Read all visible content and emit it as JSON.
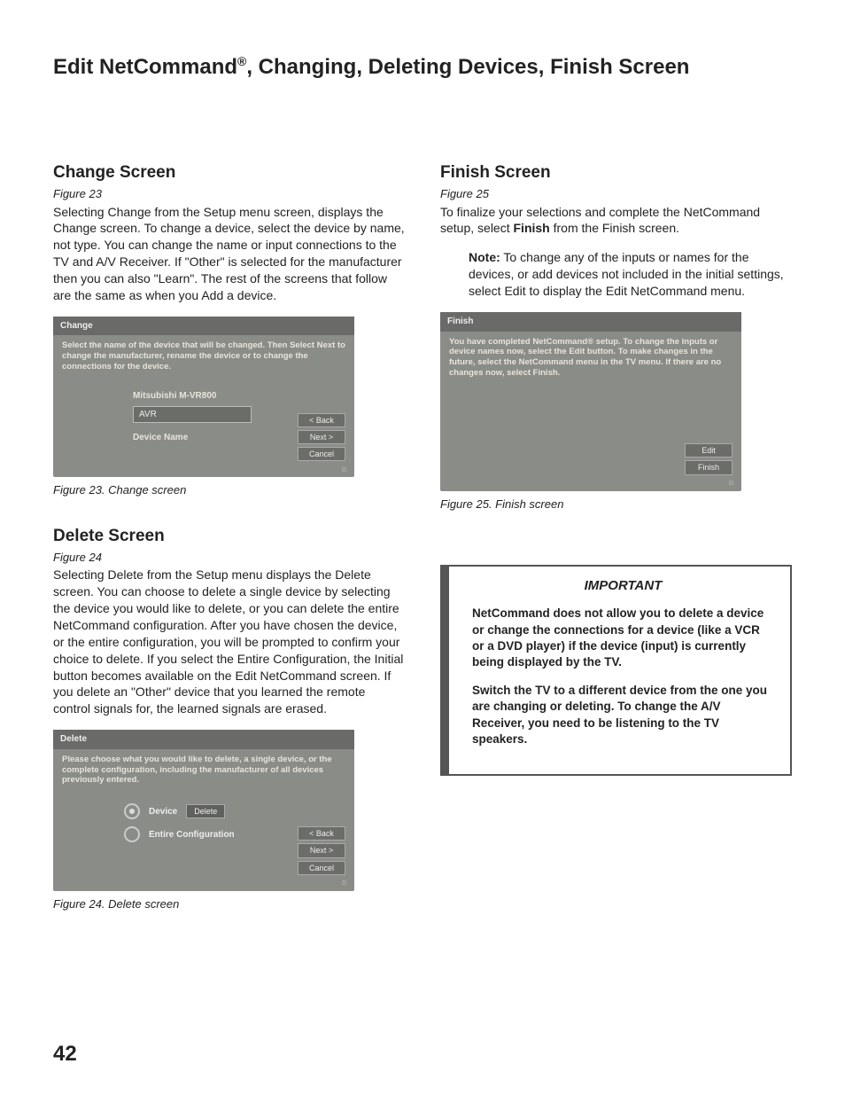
{
  "page_title_1": "Edit NetCommand",
  "page_title_reg": "®",
  "page_title_2": ", Changing, Deleting  Devices, Finish Screen",
  "change": {
    "heading": "Change Screen",
    "fig_ref": "Figure 23",
    "body": "Selecting Change from the Setup menu screen, displays the Change screen. To change a device, select the device by name, not type.  You can change the name or input connections to the TV and A/V Receiver.  If \"Other\" is selected for the manufacturer then you can also \"Learn\".  The rest of the screens that follow are the same as when you Add a device.",
    "fig_caption": "Figure 23. Change screen",
    "ss": {
      "title": "Change",
      "instr": "Select the name of the device that will be changed.  Then Select Next to change the manufacturer, rename the device or to change the connections for the device.",
      "field1": "Mitsubishi M-VR800",
      "input": "AVR",
      "field2": "Device Name",
      "back": "< Back",
      "next": "Next >",
      "cancel": "Cancel"
    }
  },
  "delete": {
    "heading": "Delete Screen",
    "fig_ref": "Figure 24",
    "body": "Selecting Delete from the Setup menu displays the Delete screen.  You can choose to delete a single device by selecting the device you would like to delete, or you can delete the entire NetCommand configuration.  After you have chosen the device, or the entire configuration, you will be prompted to confirm your choice to delete.  If you select the Entire Configuration, the Initial button becomes available on the Edit NetCommand screen.  If you delete an \"Other\" device that you learned the remote control signals for, the learned signals are erased.",
    "fig_caption": "Figure 24. Delete screen",
    "ss": {
      "title": "Delete",
      "instr": "Please choose what you would like to delete, a single device, or the complete configuration, including the manufacturer of all devices previously entered.",
      "opt1": "Device",
      "opt1_btn": "Delete",
      "opt2": "Entire Configuration",
      "back": "< Back",
      "next": "Next >",
      "cancel": "Cancel"
    }
  },
  "finish": {
    "heading": "Finish Screen",
    "fig_ref": "Figure 25",
    "body_pre": "To finalize your selections and complete the NetCommand setup, select ",
    "body_bold": "Finish",
    "body_post": " from the Finish screen.",
    "note_label": "Note:",
    "note_text": "  To change any of the inputs or names for the devices, or add devices not included in the initial settings, select Edit to display the Edit NetCommand menu.",
    "fig_caption": "Figure 25.  Finish screen",
    "ss": {
      "title": "Finish",
      "instr": "You have completed NetCommand® setup.  To change the inputs or device names now, select the Edit button.  To make changes in the future, select the NetCommand menu in the TV menu.  If there are no changes now, select Finish.",
      "edit": "Edit",
      "finish": "Finish"
    }
  },
  "important": {
    "title": "IMPORTANT",
    "p1": "NetCommand does not allow you to delete a device or change the connections for a device (like a VCR or a DVD player) if the device (input) is currently being displayed by the TV.",
    "p2": "Switch the TV to a different device from the one you are changing or deleting.  To change the A/V Receiver, you need to be listening to the TV speakers."
  },
  "page_number": "42"
}
